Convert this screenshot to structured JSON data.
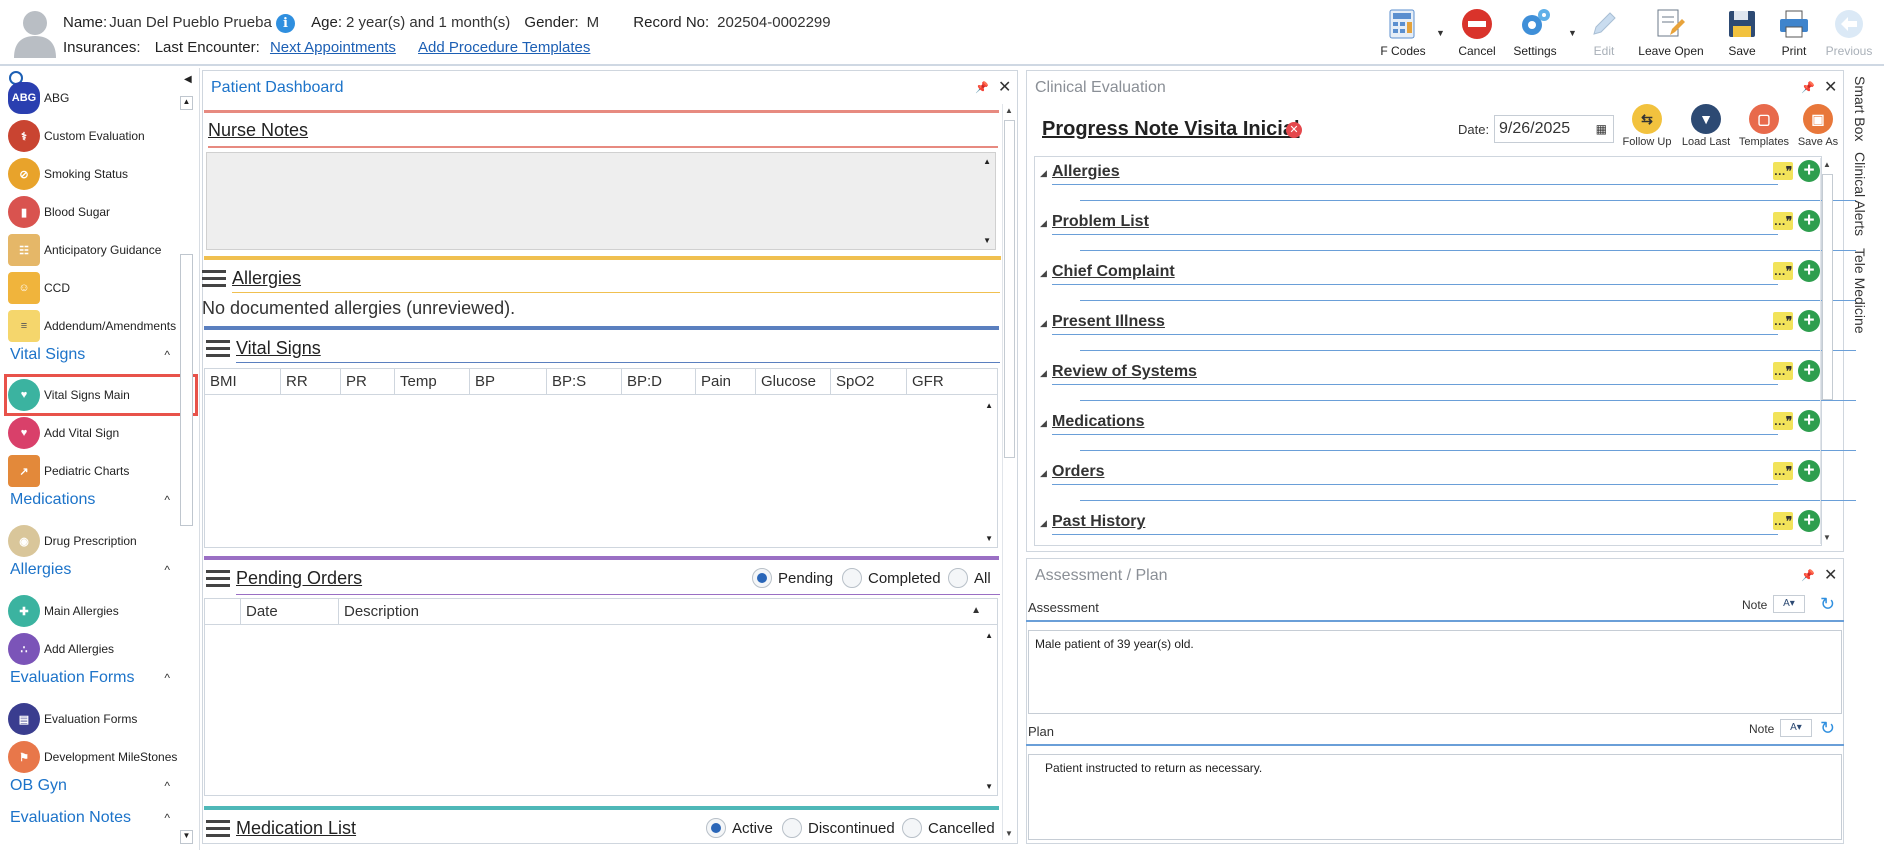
{
  "header": {
    "name_label": "Name:",
    "name_value": "Juan Del Pueblo Prueba",
    "info_glyph": "i",
    "age_label": "Age:",
    "age_value": "2 year(s) and 1 month(s)",
    "gender_label": "Gender:",
    "gender_value": "M",
    "record_label": "Record No:",
    "record_value": "202504-0002299",
    "insurances_label": "Insurances:",
    "last_encounter_label": "Last Encounter:",
    "next_appointments_link": "Next Appointments",
    "add_procedure_templates_link": "Add Procedure Templates"
  },
  "toolbar": {
    "fcodes": "F Codes",
    "cancel": "Cancel",
    "settings": "Settings",
    "edit": "Edit",
    "leave_open": "Leave Open",
    "save": "Save",
    "print": "Print",
    "previous": "Previous"
  },
  "sidebar": {
    "items_top": [
      {
        "label": "ABG",
        "icon": "abg-icon",
        "color": "#2a3fb0"
      },
      {
        "label": "Custom Evaluation",
        "icon": "stethoscope-icon",
        "color": "#c94431"
      },
      {
        "label": "Smoking Status",
        "icon": "no-smoking-icon",
        "color": "#e8a32b"
      },
      {
        "label": "Blood Sugar",
        "icon": "blood-sugar-icon",
        "color": "#d9534f"
      },
      {
        "label": "Anticipatory Guidance",
        "icon": "abacus-icon",
        "color": "#e5b768"
      },
      {
        "label": "CCD",
        "icon": "folder-person-icon",
        "color": "#f0b43c"
      },
      {
        "label": "Addendum/Amendments",
        "icon": "document-person-icon",
        "color": "#f5d66c"
      }
    ],
    "section_vital_signs": "Vital Signs",
    "vital_items": [
      {
        "label": "Vital Signs Main",
        "icon": "heartbeat-icon",
        "color": "#3bb3a0"
      },
      {
        "label": "Add Vital Sign",
        "icon": "heart-plus-icon",
        "color": "#d9406a"
      },
      {
        "label": "Pediatric Charts",
        "icon": "chart-icon",
        "color": "#e3893a"
      }
    ],
    "section_medications": "Medications",
    "medication_items": [
      {
        "label": "Drug Prescription",
        "icon": "pills-icon",
        "color": "#d9c69a"
      }
    ],
    "section_allergies": "Allergies",
    "allergy_items": [
      {
        "label": "Main Allergies",
        "icon": "allergy-kit-icon",
        "color": "#3bb3a0"
      },
      {
        "label": "Add Allergies",
        "icon": "pollen-icon",
        "color": "#7b54b8"
      }
    ],
    "section_evaluation_forms": "Evaluation Forms",
    "evaluation_items": [
      {
        "label": "Evaluation Forms",
        "icon": "clipboard-icon",
        "color": "#3a3d8f"
      },
      {
        "label": "Development MileStones",
        "icon": "milestones-icon",
        "color": "#e8774a"
      }
    ],
    "section_ob_gyn": "OB Gyn",
    "section_evaluation_notes": "Evaluation Notes"
  },
  "dashboard": {
    "title": "Patient Dashboard",
    "nurse_notes": "Nurse Notes",
    "allergies": "Allergies",
    "allergies_text": "No documented allergies (unreviewed).",
    "vital_signs": "Vital Signs",
    "vital_columns": [
      "BMI",
      "RR",
      "PR",
      "Temp",
      "BP",
      "BP:S",
      "BP:D",
      "Pain",
      "Glucose",
      "SpO2",
      "GFR"
    ],
    "pending_orders": "Pending Orders",
    "orders_filter": {
      "pending": "Pending",
      "completed": "Completed",
      "all": "All",
      "selected": "Pending"
    },
    "order_columns": [
      "Date",
      "Description"
    ],
    "medication_list": "Medication List",
    "med_filter": {
      "active": "Active",
      "discontinued": "Discontinued",
      "cancelled": "Cancelled",
      "selected": "Active"
    }
  },
  "clinical": {
    "title": "Clinical Evaluation",
    "note_title": "Progress Note Visita Inicial",
    "date_label": "Date:",
    "date_value": "9/26/2025",
    "buttons": {
      "follow_up": "Follow Up",
      "load_last": "Load Last",
      "templates": "Templates",
      "save_as": "Save As"
    },
    "sections": [
      "Allergies",
      "Problem List",
      "Chief Complaint",
      "Present Illness",
      "Review of Systems",
      "Medications",
      "Orders",
      "Past History"
    ],
    "quote_glyph": "…❞",
    "plus_glyph": "+"
  },
  "assessment": {
    "title": "Assessment / Plan",
    "assessment_label": "Assessment",
    "note_label": "Note",
    "assessment_text": "Male patient of 39 year(s) old.",
    "plan_label": "Plan",
    "plan_text": "Patient instructed to return as necessary."
  },
  "right_tabs": [
    "Smart Box",
    "Clinical Alerts",
    "Tele Medicine"
  ]
}
